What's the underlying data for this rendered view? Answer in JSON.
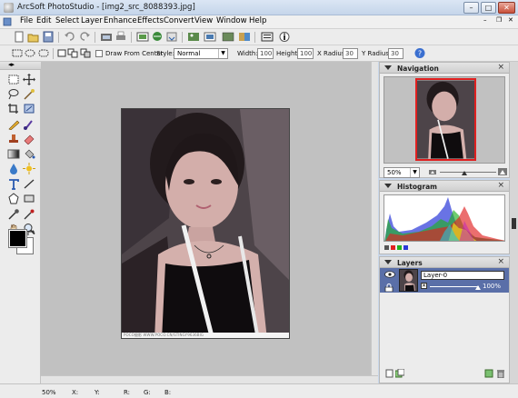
{
  "window": {
    "title": "ArcSoft PhotoStudio - [img2_src_8088393.jpg]",
    "controls": [
      "minimize",
      "maximize",
      "close"
    ]
  },
  "menu": [
    "File",
    "Edit",
    "Select",
    "Layer",
    "Enhance",
    "Effects",
    "Convert",
    "View",
    "Window",
    "Help"
  ],
  "options_bar": {
    "draw_from_center_label": "Draw From Center",
    "style_label": "Style:",
    "style_value": "Normal",
    "width_label": "Width:",
    "width_value": "100",
    "height_label": "Height:",
    "height_value": "100",
    "xradius_label": "X Radius:",
    "xradius_value": "30",
    "yradius_label": "Y Radius:",
    "yradius_value": "30"
  },
  "canvas": {
    "watermark": "POCO摄影 WWW.POCO.CN/STINGY9636BIG"
  },
  "navigator": {
    "title": "Navigation",
    "zoom": "50%"
  },
  "histogram": {
    "title": "Histogram"
  },
  "layers": {
    "title": "Layers",
    "layer_name": "Layer-0",
    "opacity": "100%"
  },
  "status": {
    "zoom": "50%",
    "x_label": "X:",
    "y_label": "Y:",
    "r_label": "R:",
    "g_label": "G:",
    "b_label": "B:"
  },
  "colors": {
    "foreground": "#000000",
    "background": "#ffffff",
    "nav_frame": "#e02020",
    "layer_selected": "#5a6fa8"
  }
}
